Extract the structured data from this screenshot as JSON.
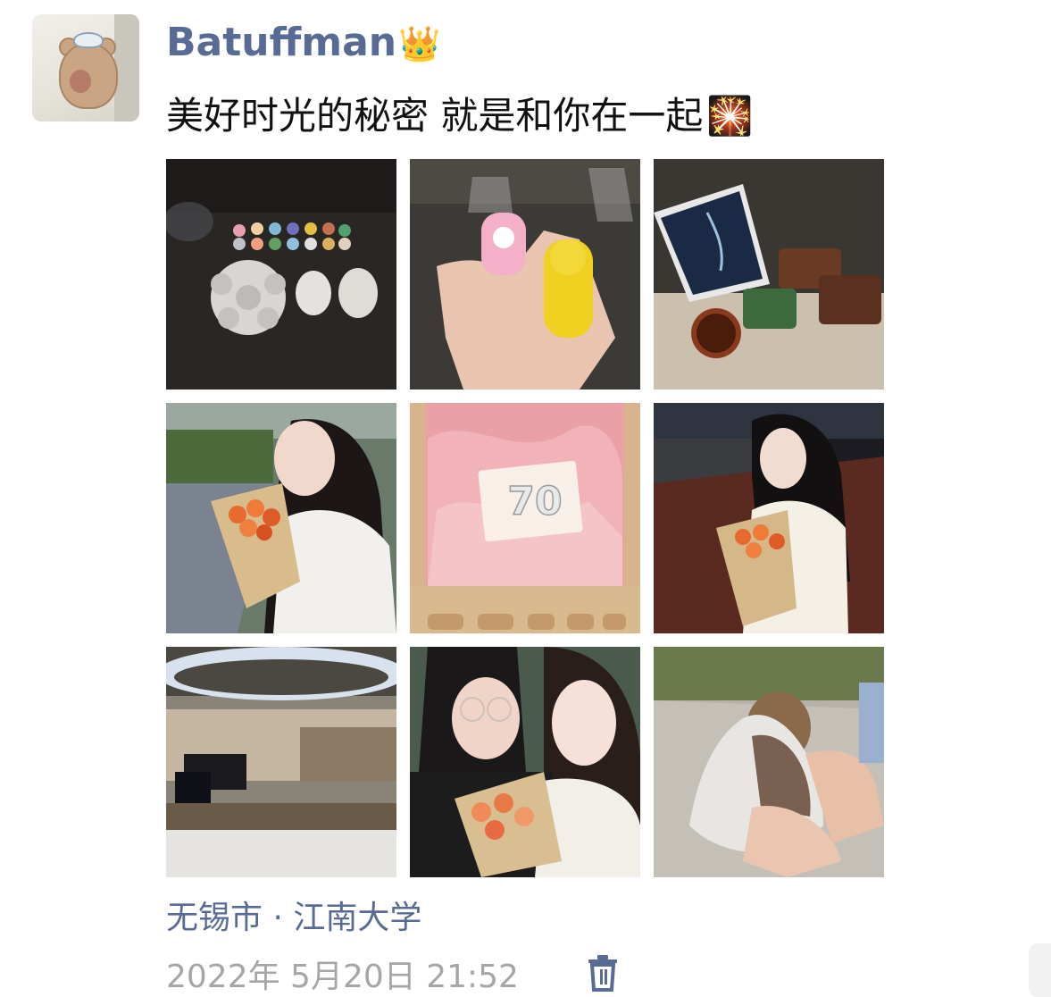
{
  "post": {
    "author": "Batuffman",
    "author_badge": "👑",
    "text": "美好时光的秘密 就是和你在一起",
    "text_deco": "🎇",
    "location": "无锡市 · 江南大学",
    "timestamp": "2022年 5月20日 21:52"
  },
  "photos": [
    {
      "name": "photo-paint-kit",
      "alt": ""
    },
    {
      "name": "photo-toy-figures",
      "alt": ""
    },
    {
      "name": "photo-tablet-food",
      "alt": ""
    },
    {
      "name": "photo-girl-bouquet-street",
      "alt": ""
    },
    {
      "name": "photo-pink-card-70",
      "alt": "",
      "card_text": "70"
    },
    {
      "name": "photo-girl-bouquet-track",
      "alt": ""
    },
    {
      "name": "photo-piano-hall",
      "alt": ""
    },
    {
      "name": "photo-couple-selfie",
      "alt": ""
    },
    {
      "name": "photo-cat",
      "alt": ""
    }
  ],
  "icons": {
    "delete": "trash-icon",
    "crown": "crown-emoji",
    "fireworks": "fireworks-emoji"
  },
  "colors": {
    "link": "#576b95",
    "text": "#111111",
    "meta": "#a6a6a6"
  }
}
